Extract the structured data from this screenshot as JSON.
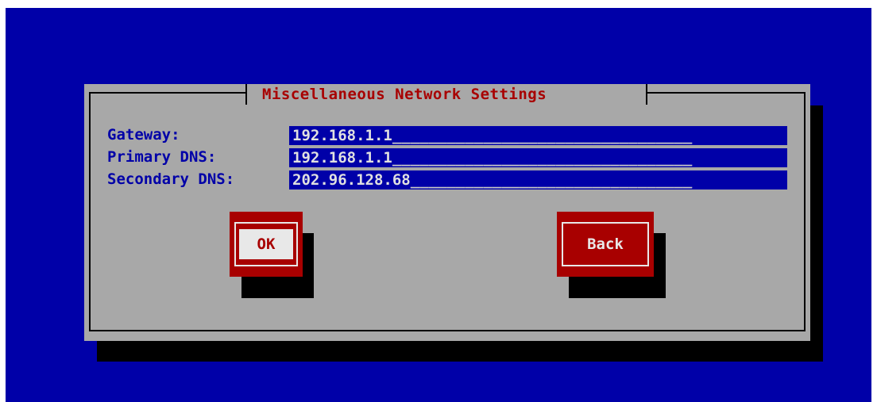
{
  "dialog": {
    "title": "Miscellaneous Network Settings"
  },
  "fields": [
    {
      "label": "Gateway:",
      "value": "192.168.1.1",
      "fill": "_________________________________"
    },
    {
      "label": "Primary DNS:",
      "value": "192.168.1.1",
      "fill": "_________________________________"
    },
    {
      "label": "Secondary DNS:",
      "value": "202.96.128.68",
      "fill": "_______________________________"
    }
  ],
  "buttons": {
    "ok_label": "OK",
    "back_label": "Back"
  },
  "colors": {
    "background": "#0000a8",
    "dialog": "#a8a8a8",
    "title": "#a80000",
    "button": "#a80000",
    "input_bg": "#0000a8"
  }
}
